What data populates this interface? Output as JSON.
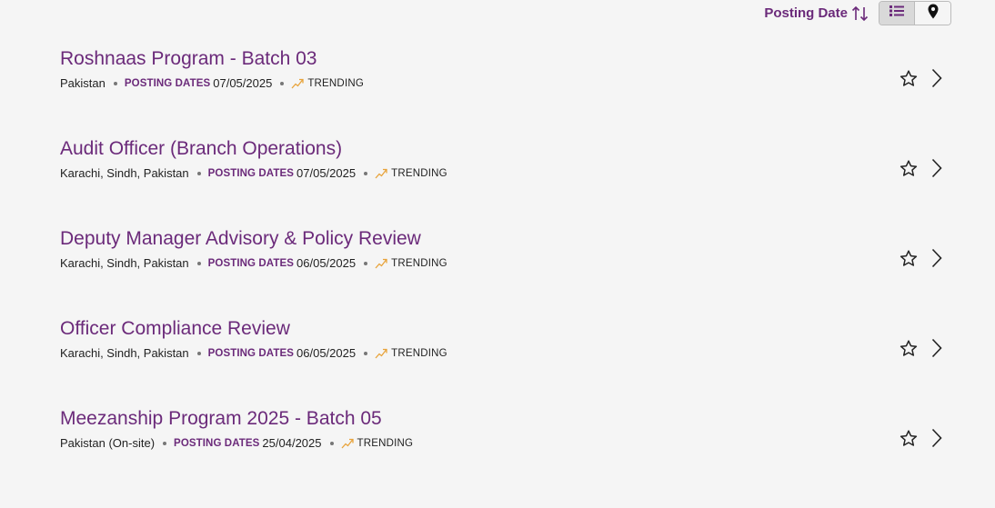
{
  "toolbar": {
    "sort_label": "Posting Date",
    "sort_icon": "sort-arrows-icon",
    "views": [
      {
        "name": "list-view",
        "icon": "list-icon",
        "active": true
      },
      {
        "name": "map-view",
        "icon": "map-pin-icon",
        "active": false
      }
    ]
  },
  "jobs": [
    {
      "title": "Roshnaas Program - Batch 03",
      "location": "Pakistan",
      "posting_label": "POSTING DATES",
      "posting_date": "07/05/2025",
      "trend_label": "TRENDING"
    },
    {
      "title": "Audit Officer (Branch Operations)",
      "location": "Karachi, Sindh, Pakistan",
      "posting_label": "POSTING DATES",
      "posting_date": "07/05/2025",
      "trend_label": "TRENDING"
    },
    {
      "title": "Deputy Manager Advisory & Policy Review",
      "location": "Karachi, Sindh, Pakistan",
      "posting_label": "POSTING DATES",
      "posting_date": "06/05/2025",
      "trend_label": "TRENDING"
    },
    {
      "title": "Officer Compliance Review",
      "location": "Karachi, Sindh, Pakistan",
      "posting_label": "POSTING DATES",
      "posting_date": "06/05/2025",
      "trend_label": "TRENDING"
    },
    {
      "title": "Meezanship Program 2025 - Batch 05",
      "location": "Pakistan (On-site)",
      "posting_label": "POSTING DATES",
      "posting_date": "25/04/2025",
      "trend_label": "TRENDING"
    }
  ],
  "colors": {
    "accent": "#6b2a7a",
    "trend": "#e8a33a",
    "background": "#f5f5f5"
  }
}
